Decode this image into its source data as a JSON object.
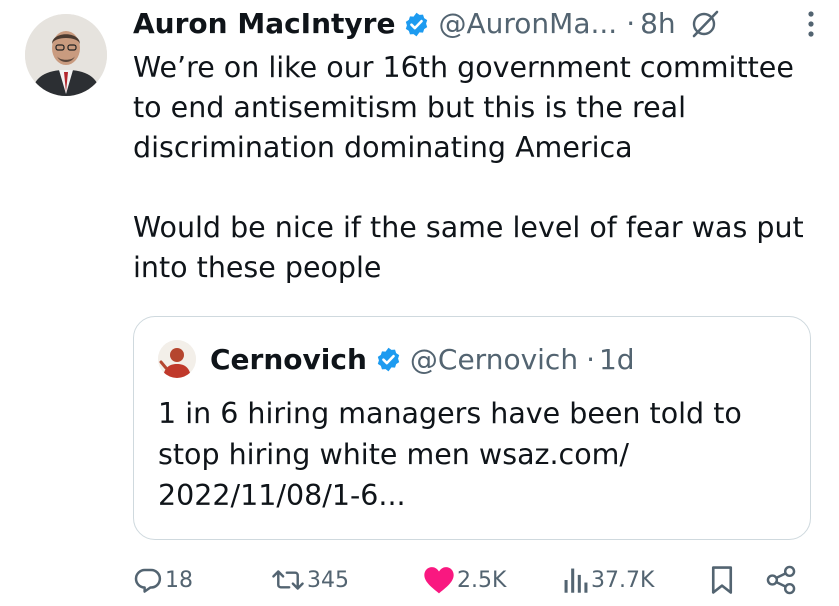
{
  "tweet": {
    "author_name": "Auron MacIntyre",
    "handle": "@AuronMa...",
    "separator": "·",
    "time": "8h",
    "text": "We’re on like our 16th government committee\nto end antisemitism but this is the real\ndiscrimination dominating America\n\nWould be nice if the same level of fear was put\ninto these people"
  },
  "quote": {
    "author_name": "Cernovich",
    "handle": "@Cernovich",
    "separator": "·",
    "time": "1d",
    "text": "1 in 6 hiring managers have been told to\nstop hiring white men wsaz.com/\n2022/11/08/1-6..."
  },
  "actions": {
    "replies": "18",
    "reposts": "345",
    "likes": "2.5K",
    "views": "37.7K"
  },
  "icons": {
    "verified": "verified-badge-icon",
    "grok": "grok-icon",
    "more": "more-options-icon",
    "reply": "reply-icon",
    "repost": "repost-icon",
    "like": "heart-icon",
    "views": "views-icon",
    "bookmark": "bookmark-icon",
    "share": "share-icon"
  },
  "colors": {
    "verified": "#1d9bf0",
    "like": "#f91880",
    "secondary_text": "#536471",
    "border": "#cfd9de"
  }
}
